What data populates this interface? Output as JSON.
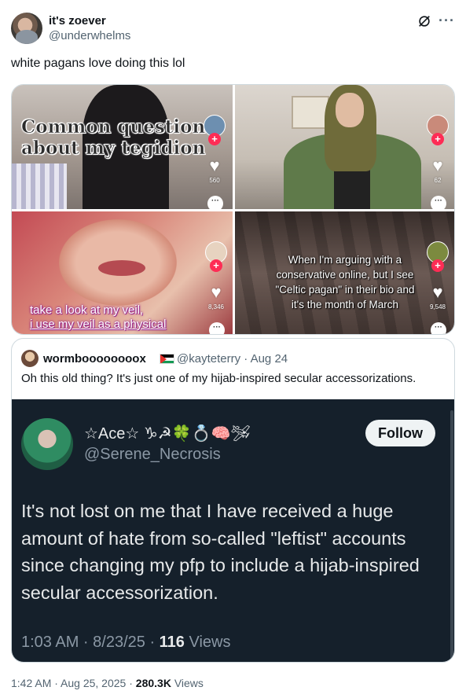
{
  "author": {
    "display_name": "it's zoever",
    "handle": "@underwhelms"
  },
  "tweet": {
    "text": "white pagans love doing this lol",
    "timestamp": "1:42 AM · Aug 25, 2025 · ",
    "views_count": "280.3K",
    "views_label": " Views"
  },
  "media": [
    {
      "caption_line1": "Common questions",
      "caption_line2": "about my tegidion",
      "likes": "560"
    },
    {
      "likes": "62"
    },
    {
      "caption_line1": "take a look at my veil,",
      "caption_line2": "i use my veil as a physical",
      "likes": "8,346"
    },
    {
      "caption": "When I'm arguing with a conservative online, but I see \"Celtic pagan\" in their bio and it's the month of March",
      "likes": "9,548"
    }
  ],
  "quote": {
    "display_name": "wormboooooooox",
    "handle_date": "@kayteterry · Aug 24",
    "text": "Oh this old thing? It's just one of my hijab-inspired secular accessorizations.",
    "embedded": {
      "display_name": "☆Ace☆ ♑︎☭🍀💍🧠🛩",
      "handle": "@Serene_Necrosis",
      "follow_label": "Follow",
      "body": "It's not lost on me that I have received a huge amount of hate from so-called \"leftist\" accounts since changing my pfp to include a hijab-inspired secular accessorization.",
      "meta_time": "1:03 AM · 8/23/25 · ",
      "meta_views": "116",
      "meta_views_label": " Views"
    }
  },
  "icons": {
    "grok": "grok-icon",
    "more": "more-icon",
    "heart": "heart-icon",
    "plus": "plus-icon",
    "dots": "dots-icon"
  },
  "colors": {
    "text": "#0f1419",
    "muted": "#536471",
    "dark_bg": "#15202b",
    "tiktok_red": "#fe2c55"
  }
}
